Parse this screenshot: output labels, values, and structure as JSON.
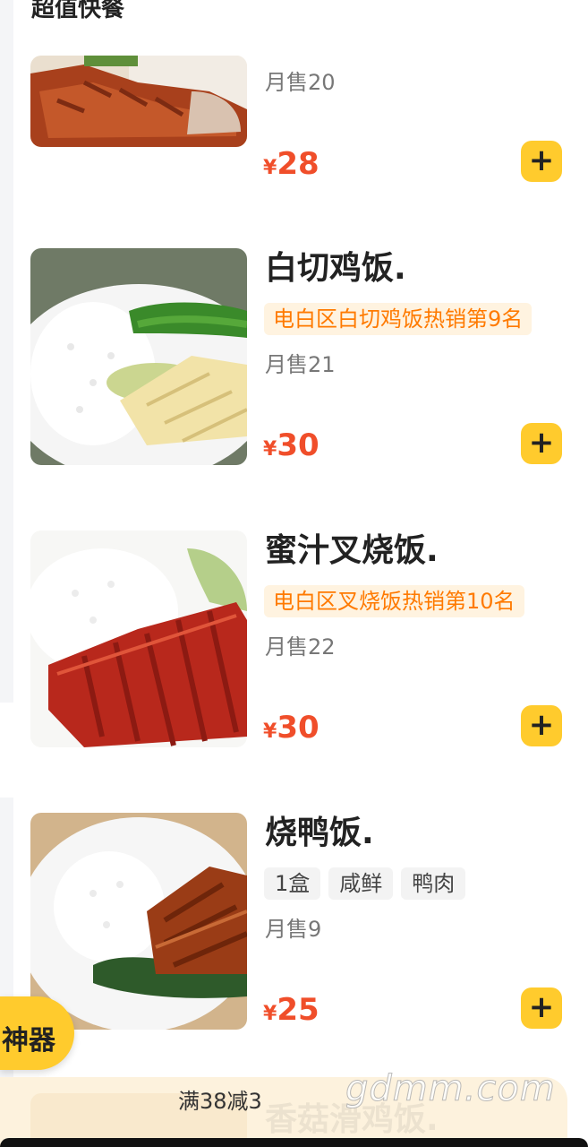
{
  "section": {
    "title": "超值快餐"
  },
  "currency": "¥",
  "items": [
    {
      "name": "",
      "rank": "",
      "tags": [],
      "sales": "月售20",
      "price": "28"
    },
    {
      "name": "白切鸡饭.",
      "rank": "电白区白切鸡饭热销第9名",
      "tags": [],
      "sales": "月售21",
      "price": "30"
    },
    {
      "name": "蜜汁叉烧饭.",
      "rank": "电白区叉烧饭热销第10名",
      "tags": [],
      "sales": "月售22",
      "price": "30"
    },
    {
      "name": "烧鸭饭.",
      "rank": "",
      "tags": [
        "1盒",
        "咸鲜",
        "鸭肉"
      ],
      "sales": "月售9",
      "price": "25"
    }
  ],
  "add_button": {
    "label": "+"
  },
  "floating_pill": {
    "label": "神器"
  },
  "promo": {
    "text": "满38减3",
    "next_item_name": "香菇滑鸡饭."
  },
  "watermark": "gdmm.com",
  "colors": {
    "accent": "#ffcb2d",
    "price": "#f04e2a",
    "rank_text": "#ff7a00",
    "rank_bg": "#fff3e0"
  },
  "icons": {
    "add": "plus-icon"
  }
}
